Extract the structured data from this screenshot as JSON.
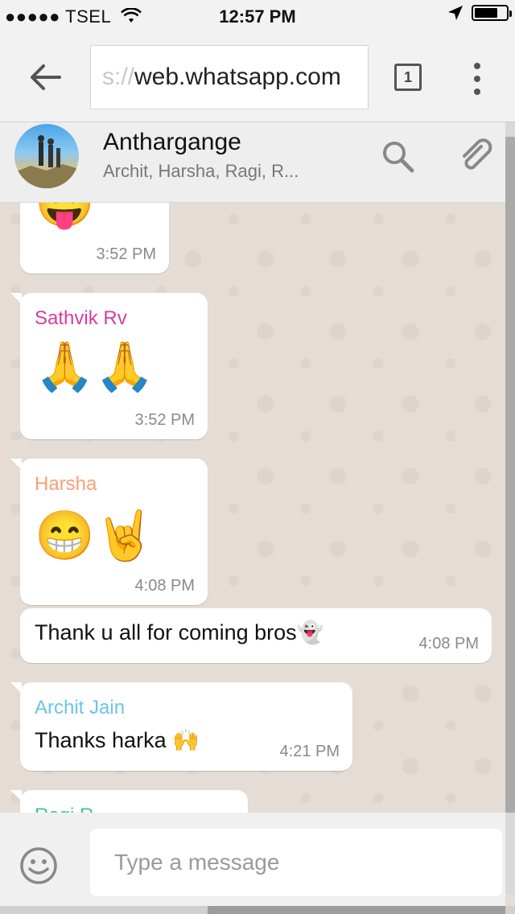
{
  "status_bar": {
    "carrier": "TSEL",
    "time": "12:57 PM"
  },
  "browser": {
    "url_scheme_fragment": "s://",
    "url_host": "web.whatsapp.com",
    "tab_count": "1"
  },
  "chat_header": {
    "group_name": "Anthargange",
    "members": "Archit, Harsha, Ragi, R..."
  },
  "messages": [
    {
      "sender": "",
      "content": "😛",
      "time": "3:52 PM"
    },
    {
      "sender": "Sathvik Rv",
      "sender_color": "#d63c9e",
      "content": "🙏🙏",
      "time": "3:52 PM"
    },
    {
      "sender": "Harsha",
      "sender_color": "#f5a17a",
      "content": "😁🤘",
      "time": "4:08 PM"
    },
    {
      "sender": "",
      "content": "Thank u all for coming bros👻",
      "time": "4:08 PM"
    },
    {
      "sender": "Archit Jain",
      "sender_color": "#6cc3e8",
      "content": "Thanks harka 🙌",
      "time": "4:21 PM"
    },
    {
      "sender": "Ragi R",
      "sender_color": "#38c79a",
      "content": "",
      "time": ""
    }
  ],
  "composer": {
    "placeholder": "Type a message"
  },
  "colors": {
    "chat_background": "#e5ddd5",
    "bubble": "#ffffff"
  }
}
